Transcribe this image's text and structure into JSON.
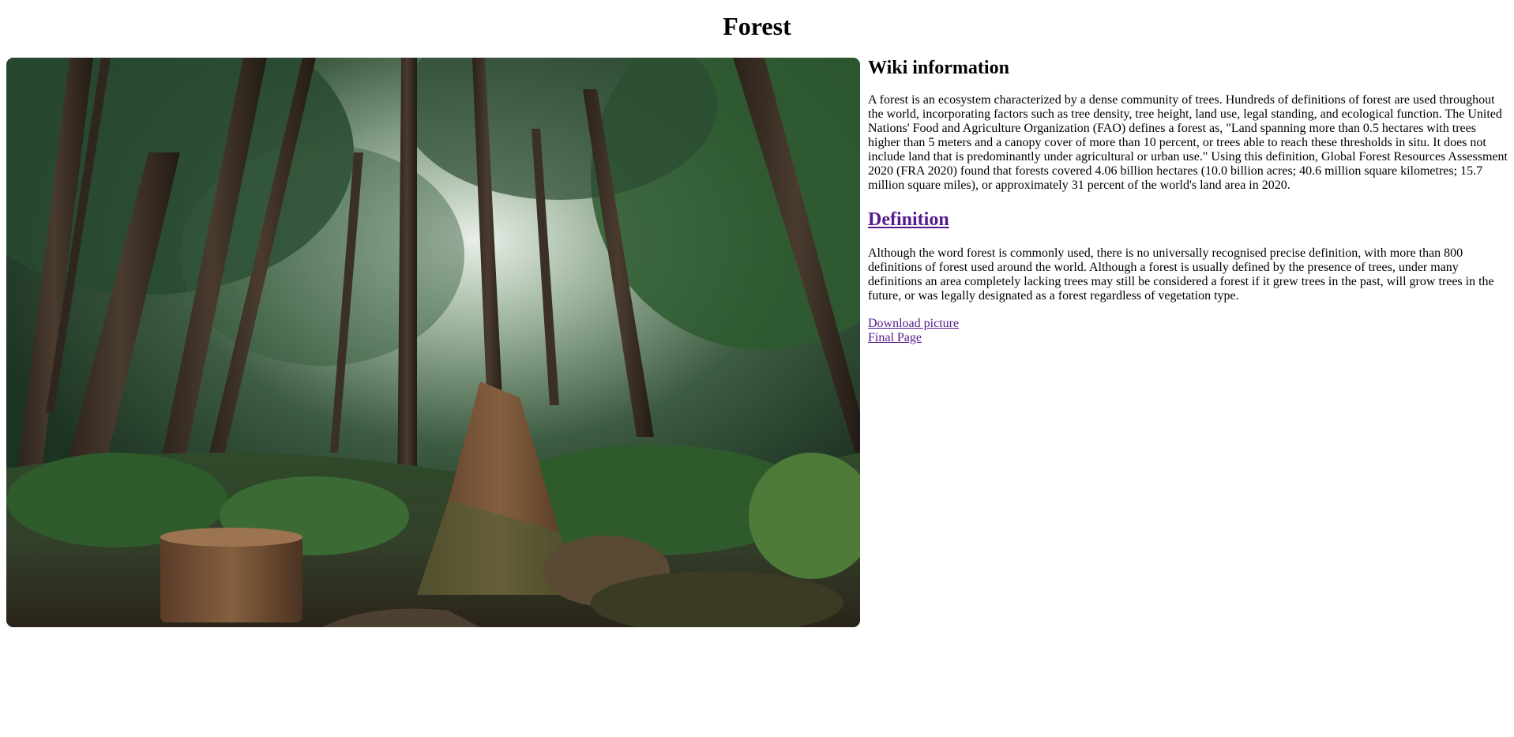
{
  "page": {
    "title": "Forest"
  },
  "photo": {
    "alt": "Forest",
    "colors": {
      "canopy_light": "#cfd8cf",
      "canopy_dark": "#1f3a27",
      "trunk": "#3b2f25",
      "fern": "#2f5a2c",
      "floor": "#3a3123",
      "stump": "#6b4a34"
    }
  },
  "info": {
    "heading": "Wiki information",
    "intro": "A forest is an ecosystem characterized by a dense community of trees. Hundreds of definitions of forest are used throughout the world, incorporating factors such as tree density, tree height, land use, legal standing, and ecological function. The United Nations' Food and Agriculture Organization (FAO) defines a forest as, \"Land spanning more than 0.5 hectares with trees higher than 5 meters and a canopy cover of more than 10 percent, or trees able to reach these thresholds in situ. It does not include land that is predominantly under agricultural or urban use.\" Using this definition, Global Forest Resources Assessment 2020 (FRA 2020) found that forests covered 4.06 billion hectares (10.0 billion acres; 40.6 million square kilometres; 15.7 million square miles), or approximately 31 percent of the world's land area in 2020.",
    "definition_heading": "Definition",
    "definition_text": "Although the word forest is commonly used, there is no universally recognised precise definition, with more than 800 definitions of forest used around the world. Although a forest is usually defined by the presence of trees, under many definitions an area completely lacking trees may still be considered a forest if it grew trees in the past, will grow trees in the future, or was legally designated as a forest regardless of vegetation type.",
    "links": {
      "download": "Download picture",
      "final": "Final Page"
    }
  }
}
